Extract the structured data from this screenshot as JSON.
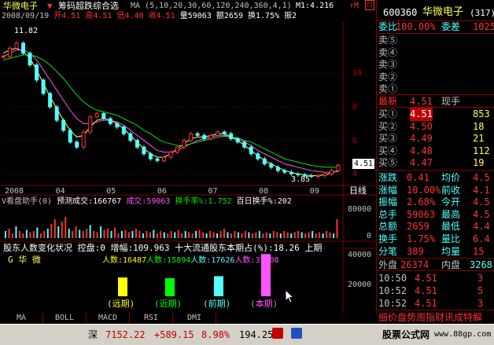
{
  "title": {
    "name": "华微电子",
    "indicator": "筹码超跌综合选",
    "ma_params": "MA (5,10,20,30,60,120,240,360,4,1)",
    "m1": "M1:4.216",
    "m1_arrow": "↑M",
    "date": "2008/09/19",
    "open_label": "开",
    "open_val": "4.51",
    "high_label": "高",
    "high_val": "4.51",
    "low_label": "低",
    "low_val": "4.40",
    "close_label": "收",
    "close_val": "4.51",
    "vol_label": "量",
    "vol_val": "59063",
    "amt_label": "额",
    "amt_val": "2659",
    "turn_label": "换",
    "turn_val": "1.75%",
    "amp_label": "振",
    "amp_val": "2",
    "peak_label": "11.82"
  },
  "chart_data": {
    "type": "line",
    "title": "华微电子",
    "x_ticks": [
      "2008",
      "04",
      "05",
      "06",
      "07",
      "08",
      "09"
    ],
    "y_ticks": [
      10.0,
      8.0,
      6.0,
      4.0
    ],
    "ylim": [
      3.5,
      12.5
    ],
    "series": [
      {
        "name": "price",
        "x": [
          0,
          2,
          4,
          6,
          8,
          10,
          12,
          14,
          16,
          18,
          20,
          22,
          24,
          26,
          28,
          30,
          32,
          34,
          36,
          38,
          40,
          42,
          44,
          46,
          48,
          50,
          52,
          54,
          56,
          58,
          60,
          62,
          64,
          66,
          68,
          70,
          72,
          74,
          76,
          78,
          80,
          82,
          84,
          86,
          88,
          90,
          92,
          94,
          96,
          98,
          100
        ],
        "values": [
          11.0,
          11.5,
          11.8,
          11.2,
          10.5,
          9.6,
          8.8,
          8.0,
          7.2,
          6.6,
          5.9,
          5.6,
          6.5,
          7.4,
          7.6,
          7.3,
          7.0,
          6.8,
          6.4,
          6.0,
          5.6,
          5.2,
          4.9,
          4.8,
          5.0,
          5.3,
          5.6,
          6.0,
          6.4,
          6.3,
          6.1,
          6.3,
          6.5,
          6.4,
          6.1,
          5.9,
          5.6,
          5.2,
          4.9,
          4.6,
          4.4,
          4.2,
          4.1,
          4.0,
          3.95,
          3.9,
          3.85,
          3.9,
          4.0,
          4.2,
          4.51
        ]
      },
      {
        "name": "ma_short",
        "values": [
          11.2,
          11.4,
          11.5,
          11.3,
          10.9,
          10.2,
          9.4,
          8.6,
          7.9,
          7.2,
          6.6,
          6.2,
          6.3,
          6.8,
          7.2,
          7.3,
          7.2,
          7.0,
          6.7,
          6.3,
          5.9,
          5.5,
          5.2,
          5.0,
          5.0,
          5.2,
          5.5,
          5.8,
          6.1,
          6.2,
          6.2,
          6.3,
          6.4,
          6.4,
          6.2,
          6.0,
          5.7,
          5.4,
          5.1,
          4.8,
          4.6,
          4.4,
          4.2,
          4.1,
          4.0,
          3.95,
          3.9,
          3.9,
          3.95,
          4.05,
          4.2
        ]
      },
      {
        "name": "ma_mid",
        "values": [
          11.0,
          11.2,
          11.4,
          11.4,
          11.2,
          10.8,
          10.2,
          9.6,
          9.0,
          8.4,
          7.8,
          7.3,
          7.0,
          7.0,
          7.1,
          7.2,
          7.2,
          7.1,
          6.9,
          6.6,
          6.3,
          6.0,
          5.7,
          5.4,
          5.3,
          5.3,
          5.4,
          5.6,
          5.8,
          6.0,
          6.1,
          6.2,
          6.3,
          6.3,
          6.2,
          6.1,
          5.9,
          5.7,
          5.4,
          5.2,
          5.0,
          4.8,
          4.6,
          4.5,
          4.4,
          4.3,
          4.2,
          4.15,
          4.1,
          4.1,
          4.15
        ]
      },
      {
        "name": "ma_long",
        "values": [
          10.8,
          10.9,
          11.0,
          11.1,
          11.1,
          11.0,
          10.8,
          10.5,
          10.1,
          9.7,
          9.2,
          8.7,
          8.3,
          8.0,
          7.8,
          7.7,
          7.6,
          7.5,
          7.3,
          7.1,
          6.9,
          6.6,
          6.4,
          6.1,
          5.9,
          5.8,
          5.7,
          5.7,
          5.8,
          5.9,
          6.0,
          6.1,
          6.2,
          6.25,
          6.2,
          6.15,
          6.0,
          5.9,
          5.7,
          5.5,
          5.3,
          5.1,
          4.9,
          4.8,
          4.7,
          4.6,
          4.5,
          4.45,
          4.4,
          4.4,
          4.4
        ]
      }
    ],
    "low_label": "3.85"
  },
  "price_tag": "4.51",
  "volume": {
    "header": "V看盘助手(0)",
    "pred_label": "预测成交:",
    "pred_val": "166767",
    "deal_label": "成交:",
    "deal_val": "59063",
    "turn_label": "换手率%:",
    "turn_val": "1.752",
    "hundred_label": "百日换手%:",
    "hundred_val": "202",
    "y_ticks": [
      "80000",
      "40000",
      "0"
    ],
    "bars": [
      0.3,
      0.4,
      0.2,
      0.5,
      0.3,
      0.2,
      0.35,
      0.25,
      0.3,
      0.45,
      0.2,
      0.3,
      0.4,
      0.6,
      0.8,
      0.5,
      0.7,
      0.9,
      0.4,
      0.3,
      0.5,
      0.35,
      0.3,
      0.4,
      0.55,
      0.3,
      0.25,
      0.5,
      0.35,
      0.4,
      0.3,
      0.45,
      0.2,
      0.3,
      0.35,
      0.25,
      0.3,
      0.4,
      0.3,
      0.2,
      0.3,
      0.25,
      0.35,
      0.2,
      0.3,
      0.25,
      0.2,
      0.3,
      0.25,
      0.35,
      0.2,
      0.3,
      0.25,
      0.2,
      0.3,
      0.35,
      0.25,
      0.2,
      0.3,
      0.25,
      0.2,
      0.3,
      0.4,
      0.25,
      0.2,
      0.3,
      0.25,
      0.2,
      0.3,
      0.25,
      0.2,
      0.25,
      0.3,
      0.2,
      0.25,
      0.2,
      0.3,
      0.25,
      0.2,
      0.3,
      0.25,
      0.2,
      0.25,
      0.3,
      0.25,
      0.2,
      0.25,
      0.3,
      0.2,
      0.25,
      0.2,
      0.3,
      0.25,
      0.2,
      0.8
    ]
  },
  "holders": {
    "header": "股东人数变化状况",
    "ctrl_label": "控盘:",
    "ctrl_val": "0",
    "inc_label": "增幅:",
    "inc_val": "109.963",
    "top10_label": "十大流通股东本期占(%):",
    "top10_val": "18.26",
    "last_label": "上期",
    "stock_name": "G 华 微",
    "counts": [
      {
        "label": "人数:",
        "value": "16487",
        "color": "#ffff00"
      },
      {
        "label": "人数:",
        "value": "15894",
        "color": "#00ff00"
      },
      {
        "label": "人数:",
        "value": "17626",
        "color": "#54ffff"
      },
      {
        "label": "人数:",
        "value": "37008",
        "color": "#ff54ff"
      }
    ],
    "bar_labels": [
      "(远期)",
      "(近期)",
      "(前期)",
      "(本期)"
    ],
    "bar_values": [
      16487,
      15894,
      17626,
      37008
    ],
    "y_ticks": [
      "40000",
      "20000"
    ]
  },
  "tabs": [
    "MA",
    "BOLL",
    "MACD",
    "RSI",
    "DMI"
  ],
  "quote": {
    "code": "600360",
    "name": "华微电子",
    "num": "(317)",
    "weibi_label": "委比",
    "weibi_val": "100.00%",
    "weicha_label": "委差",
    "weicha_val": "1025",
    "sell": [
      {
        "label": "卖⑤",
        "price": "",
        "vol": ""
      },
      {
        "label": "卖④",
        "price": "",
        "vol": ""
      },
      {
        "label": "卖③",
        "price": "",
        "vol": ""
      },
      {
        "label": "卖②",
        "price": "",
        "vol": ""
      },
      {
        "label": "卖①",
        "price": "",
        "vol": ""
      }
    ],
    "last_label": "最新",
    "last_val": "4.51",
    "cur_label": "现手",
    "cur_val": "",
    "buy": [
      {
        "label": "买①",
        "price": "4.51",
        "vol": "853"
      },
      {
        "label": "买②",
        "price": "4.50",
        "vol": "18"
      },
      {
        "label": "买③",
        "price": "4.49",
        "vol": "21"
      },
      {
        "label": "买④",
        "price": "4.48",
        "vol": "112"
      },
      {
        "label": "买⑤",
        "price": "4.47",
        "vol": "19"
      }
    ],
    "stats": [
      {
        "l1": "涨跌",
        "v1": "0.41",
        "l2": "均价",
        "v2": "4.5"
      },
      {
        "l1": "涨幅",
        "v1": "10.00%",
        "l2": "前收",
        "v2": "4.1"
      },
      {
        "l1": "振幅",
        "v1": "2.68%",
        "l2": "今开",
        "v2": "4.5"
      },
      {
        "l1": "总手",
        "v1": "59063",
        "l2": "最高",
        "v2": "4.5"
      },
      {
        "l1": "总额",
        "v1": "2659",
        "l2": "最低",
        "v2": "4.4"
      },
      {
        "l1": "换手",
        "v1": "1.75%",
        "l2": "量比",
        "v2": "6.4"
      },
      {
        "l1": "分笔",
        "v1": "389",
        "l2": "均量",
        "v2": "15"
      }
    ],
    "outer_label": "外盘",
    "outer_val": "26374",
    "inner_label": "内盘",
    "inner_val": "3268",
    "ticks": [
      {
        "time": "10:50",
        "price": "4.51",
        "vol": "3"
      },
      {
        "time": "10:52",
        "price": "4.51",
        "vol": "5"
      },
      {
        "time": "10:52",
        "price": "4.51",
        "vol": "3"
      }
    ],
    "footer": "细价盘势周指财讯成特解"
  },
  "status": {
    "market": "深",
    "index": "7152.22",
    "change": "+589.15",
    "pct": "8.98%",
    "amount": "194.25亿",
    "brand": "股票公式网",
    "url": "www.88gp.com"
  },
  "colors": {
    "up": "#ff3232",
    "down": "#54ffff",
    "frame": "#800000"
  }
}
